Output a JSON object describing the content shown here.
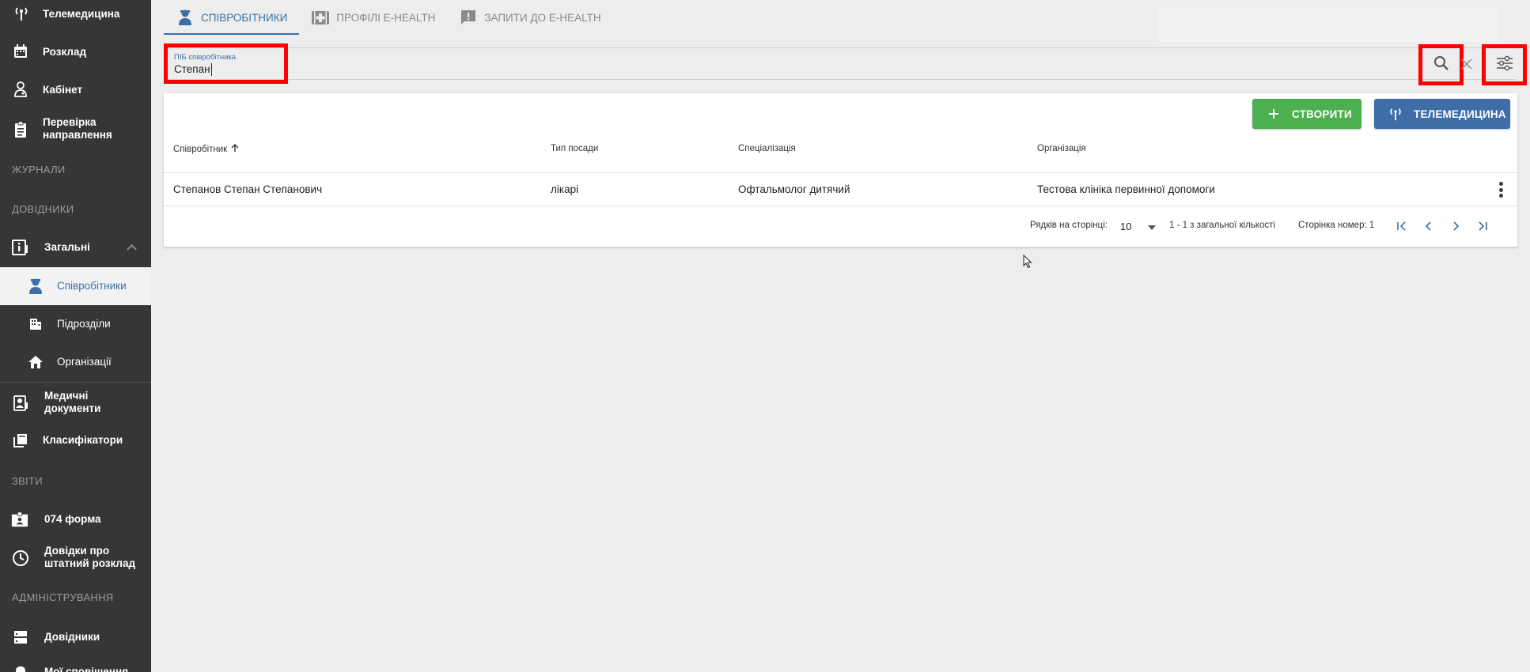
{
  "sidebar": {
    "items": [
      {
        "label": "Телемедицина",
        "icon": "antenna-icon"
      },
      {
        "label": "Розклад",
        "icon": "calendar-icon"
      },
      {
        "label": "Кабінет",
        "icon": "doctor-icon"
      },
      {
        "label": "Перевірка направлення",
        "icon": "clipboard-icon"
      },
      {
        "label": "Загальні",
        "icon": "info-badge-icon"
      },
      {
        "label": "Співробітники",
        "icon": "staff-icon"
      },
      {
        "label": "Підрозділи",
        "icon": "building-icon"
      },
      {
        "label": "Організації",
        "icon": "home-icon"
      },
      {
        "label": "Медичні документи",
        "icon": "medical-doc-icon"
      },
      {
        "label": "Класифікатори",
        "icon": "library-icon"
      },
      {
        "label": "074 форма",
        "icon": "id-card-icon"
      },
      {
        "label": "Довідки про штатний розклад",
        "icon": "clock-icon"
      },
      {
        "label": "Довідники",
        "icon": "server-icon"
      },
      {
        "label": "Мої сповіщення",
        "icon": "bell-icon"
      }
    ],
    "sections": {
      "journals": "ЖУРНАЛИ",
      "references": "ДОВІДНИКИ",
      "reports": "ЗВІТИ",
      "admin": "АДМІНІСТРУВАННЯ"
    }
  },
  "tabs": [
    {
      "label": "Співробітники",
      "icon": "staff-icon"
    },
    {
      "label": "Профілі E-HEALTH",
      "icon": "medical-plus-icon"
    },
    {
      "label": "Запити до E-HEALTH",
      "icon": "alert-message-icon"
    }
  ],
  "search": {
    "label": "ПІБ співробітника",
    "value": "Степан"
  },
  "toolbar": {
    "create_label": "Створити",
    "telemedicine_label": "Телемедицина"
  },
  "table": {
    "columns": [
      "Співробітник",
      "Тип посади",
      "Спеціалізація",
      "Організація"
    ],
    "rows": [
      [
        "Степанов Степан Степанович",
        "лікарі",
        "Офтальмолог дитячий",
        "Тестова клініка первинної допомоги"
      ]
    ]
  },
  "pagination": {
    "rows_per_page_label": "Рядків на сторінці:",
    "rows_per_page": "10",
    "range_text": "1 - 1 з загальної кількості",
    "page_label": "Сторінка номер: 1"
  },
  "colors": {
    "sidebar_bg": "#363636",
    "accent": "#3b6fa8",
    "create_green": "#4caf50",
    "highlight_red": "#ff0000"
  }
}
